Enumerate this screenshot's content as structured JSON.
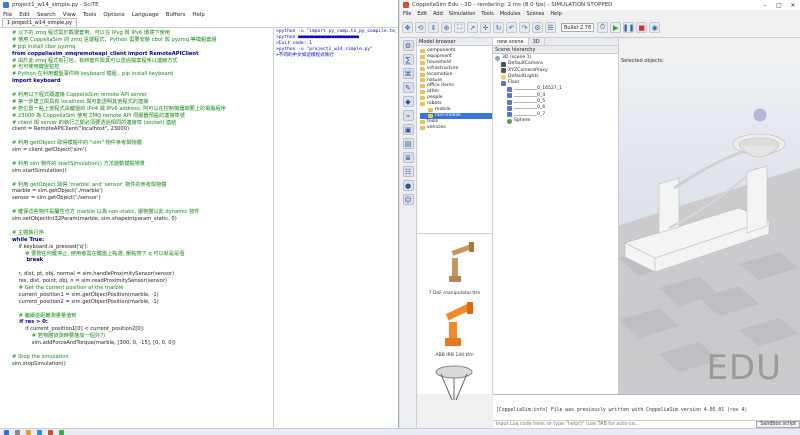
{
  "scite": {
    "title": "project1_w14_simple.py - SciTE",
    "menu": [
      "File",
      "Edit",
      "Search",
      "View",
      "Tools",
      "Options",
      "Language",
      "Buffers",
      "Help"
    ],
    "tab": "1 project1_w14_simple.py",
    "code": [
      {
        "t": "# 以下的 zmq 程式需於截選套用，可以在 IPvg 與 IPv6 環境下使用",
        "c": "comment"
      },
      {
        "t": "# 使用 CoppeliaSim 的 zmq 遠端程式，Python 需要安裝 cbor 與 pyzmq 等模組套組",
        "c": "comment"
      },
      {
        "t": "# pip install cbor pyzmq",
        "c": "comment"
      },
      {
        "t": "from coppeliasim_zmqremoteapi_client import RemoteAPIClient",
        "c": "kw"
      },
      {
        "t": "# 由於此 zmq 程式有打包，有將套件與其可以透過檔案程序以連線方式",
        "c": "comment"
      },
      {
        "t": "# 也可使用鍵盤監控",
        "c": "comment"
      },
      {
        "t": "# Python 在利用鍵盤事件時 keyboard 模組，pip install keyboard",
        "c": "comment"
      },
      {
        "t": "import keyboard",
        "c": "kw"
      },
      {
        "t": "",
        "c": ""
      },
      {
        "t": "# 利用以下程式碼連接 CoppeliaSim remote API server",
        "c": "comment"
      },
      {
        "t": "# 第一步建立與具有 localhost 與可能透明其他程式的連接",
        "c": "comment"
      },
      {
        "t": "# 若位置一點上當程式由鍵盤的 IPv4 或 IPv6 address, 則可以在控制機器端要上的電腦程序",
        "c": "comment"
      },
      {
        "t": "# 23000 為 CoppeliaSim 使用 ZMQ remote API 伺服器預設的連接埠號",
        "c": "comment"
      },
      {
        "t": "# client 與 server 的執行之間必須要透過相同的連接埠 (socket) 連結",
        "c": "comment"
      },
      {
        "t": "client = RemoteAPIClient(\"localhost\", 23000)",
        "c": ""
      },
      {
        "t": "",
        "c": ""
      },
      {
        "t": "# 利用 getObject 取得模擬中的 \"sim\" 物件參考與物體",
        "c": "comment"
      },
      {
        "t": "sim = client.getObject('sim')",
        "c": ""
      },
      {
        "t": "",
        "c": ""
      },
      {
        "t": "# 利用 sim 物件的 startSimulation() 方法啟動模擬場景",
        "c": "comment"
      },
      {
        "t": "sim.startSimulation()",
        "c": ""
      },
      {
        "t": "",
        "c": ""
      },
      {
        "t": "# 利用 getObject 取得 'marble' and 'sensor' 物件的參考與物體",
        "c": "comment"
      },
      {
        "t": "marble = sim.getObject('./marble')",
        "c": ""
      },
      {
        "t": "sensor = sim.getObject('./sensor')",
        "c": ""
      },
      {
        "t": "",
        "c": ""
      },
      {
        "t": "# 確保這些物件是屬性也方 marble 以為 non-static, 讓物體以此 dynamic 物件",
        "c": "comment"
      },
      {
        "t": "sim.setObjectInt32Param(marble, sim.shapeintparam_static, 0)",
        "c": ""
      },
      {
        "t": "",
        "c": ""
      },
      {
        "t": "# 主體執行序",
        "c": "comment"
      },
      {
        "t": "while True:",
        "c": "kw"
      },
      {
        "t": "    if keyboard.is_pressed('q'):",
        "c": ""
      },
      {
        "t": "        # 要按任何鍵停止, 使用者需在鍵盤上點選, 壓點按下 q 可以就是是個",
        "c": "comment"
      },
      {
        "t": "        break",
        "c": "kw"
      },
      {
        "t": "",
        "c": ""
      },
      {
        "t": "    r, dist, pt, obj, normal = sim.handleProximitySensor(sensor)",
        "c": ""
      },
      {
        "t": "    res, dist, point, obj, n = sim.readProximitySensor(sensor)",
        "c": ""
      },
      {
        "t": "    # Get the current position of the marble",
        "c": "comment"
      },
      {
        "t": "    current_position1 = sim.getObjectPosition(marble, -1)",
        "c": ""
      },
      {
        "t": "    current_position2 = sim.getObjectPosition(marble, -1)",
        "c": ""
      },
      {
        "t": "",
        "c": ""
      },
      {
        "t": "    # 繼續從距離測量量值到",
        "c": "comment"
      },
      {
        "t": "    if res > 0:",
        "c": "kw"
      },
      {
        "t": "        if current_position1[0] < current_position2[0]:",
        "c": ""
      },
      {
        "t": "            # 若物體偵測時要施加一個外力",
        "c": "comment"
      },
      {
        "t": "            sim.addForceAndTorque(marble, [300, 0, -15], [0, 0, 0])",
        "c": ""
      },
      {
        "t": "",
        "c": ""
      },
      {
        "t": "# Stop the simulation",
        "c": "comment"
      },
      {
        "t": "sim.stopSimulation()",
        "c": ""
      }
    ],
    "output": [
      ">python -u \"import py_comp.to_py_compile.to_project\"",
      ">python ■■■■■■■■■■■■■■■■■■■■■■",
      ">Exit code: 1",
      ">python -u \"project1_w14_simple.py\"",
      ">不同的中文如這樣程式執行"
    ]
  },
  "coppelia": {
    "title": "CoppeliaSim Edu - 3D - rendering: 2 ms (8.0 fps) - SIMULATION STOPPED",
    "menu": [
      "File",
      "Edit",
      "Add",
      "Simulation",
      "Tools",
      "Modules",
      "Scenes",
      "Help"
    ],
    "engine": "Bullet 2.78",
    "model_browser_title": "Model browser",
    "folders": [
      "components",
      "equipment",
      "household",
      "infrastructure",
      "locomotion",
      "nature",
      "office items",
      "other",
      "people",
      "robots",
      "mobile",
      "non-mobile",
      "tools",
      "vehicles"
    ],
    "selected_folder": "non-mobile",
    "thumbs": [
      "7 DoF manipulator.ttm",
      "ABB IRB 140.ttm",
      ""
    ],
    "scene_tabs": [
      "new scene",
      "3D"
    ],
    "hierarchy_title": "Scene hierarchy",
    "tree": [
      {
        "label": "3D (scene 1)",
        "d": 0,
        "k": "root"
      },
      {
        "label": "DefaultCamera",
        "d": 1,
        "k": "cam"
      },
      {
        "label": "XYZCameraProxy",
        "d": 1,
        "k": "cam"
      },
      {
        "label": "DefaultLights",
        "d": 1,
        "k": "light"
      },
      {
        "label": "Floor",
        "d": 1,
        "k": "shape"
      },
      {
        "label": "__________0_16527_1",
        "d": 2,
        "k": "shape"
      },
      {
        "label": "__________0_4",
        "d": 2,
        "k": "shape"
      },
      {
        "label": "__________0_5",
        "d": 2,
        "k": "shape"
      },
      {
        "label": "__________0_6",
        "d": 2,
        "k": "shape"
      },
      {
        "label": "__________0_7",
        "d": 2,
        "k": "shape"
      },
      {
        "label": "Sphere",
        "d": 2,
        "k": "sphere"
      }
    ],
    "selection_label": "Selected objects:",
    "edu_watermark": "EDU",
    "console": [
      "[CoppeliaSim:info] File was previously written with CoppeliaSim version 4.05.01 (rev 4)",
      "[CoppeliaSim:info] Scene opened."
    ],
    "lua_placeholder": "Input Lua code here, or type \"help()\" (use TAB for auto-co...",
    "sandbox": "Sandbox script"
  },
  "colors": {
    "accent": "#3a76d8",
    "comment": "#118811",
    "keyword": "#00008b"
  }
}
